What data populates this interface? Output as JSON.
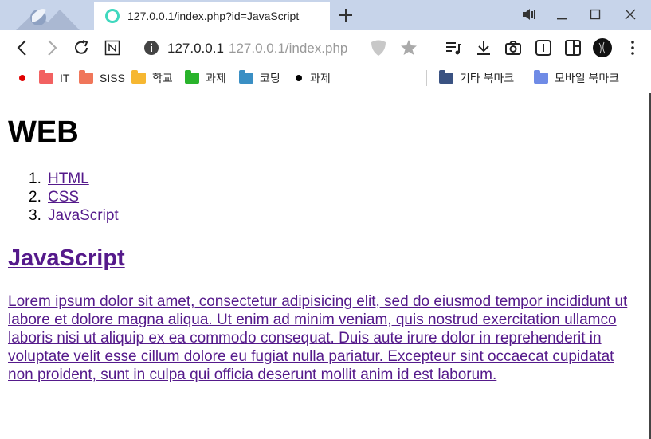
{
  "browser": {
    "tab_title": "127.0.0.1/index.php?id=JavaScript",
    "url_host": "127.0.0.1",
    "url_path": "127.0.0.1/index.php"
  },
  "bookmarks": [
    {
      "label": "",
      "kind": "dot",
      "color": "#e00000"
    },
    {
      "label": "IT",
      "kind": "folder",
      "color": "#f26161"
    },
    {
      "label": "SISS",
      "kind": "folder",
      "color": "#f0765a"
    },
    {
      "label": "학교",
      "kind": "folder",
      "color": "#f6b731"
    },
    {
      "label": "과제",
      "kind": "folder",
      "color": "#29b32b"
    },
    {
      "label": "코딩",
      "kind": "folder",
      "color": "#3a8fc4"
    },
    {
      "label": "과제",
      "kind": "dot",
      "color": "#000000"
    }
  ],
  "bookmarks_right": [
    {
      "label": "기타 북마크",
      "color": "#3a5282"
    },
    {
      "label": "모바일 북마크",
      "color": "#6f8be6"
    }
  ],
  "page": {
    "heading": "WEB",
    "nav": [
      {
        "num": "1.",
        "label": "HTML"
      },
      {
        "num": "2.",
        "label": "CSS"
      },
      {
        "num": "3.",
        "label": "JavaScript"
      }
    ],
    "title": "JavaScript",
    "body": "Lorem ipsum dolor sit amet, consectetur adipisicing elit, sed do eiusmod tempor incididunt ut labore et dolore magna aliqua. Ut enim ad minim veniam, quis nostrud exercitation ullamco laboris nisi ut aliquip ex ea commodo consequat. Duis aute irure dolor in reprehenderit in voluptate velit esse cillum dolore eu fugiat nulla pariatur. Excepteur sint occaecat cupidatat non proident, sunt in culpa qui officia deserunt mollit anim id est laborum."
  }
}
